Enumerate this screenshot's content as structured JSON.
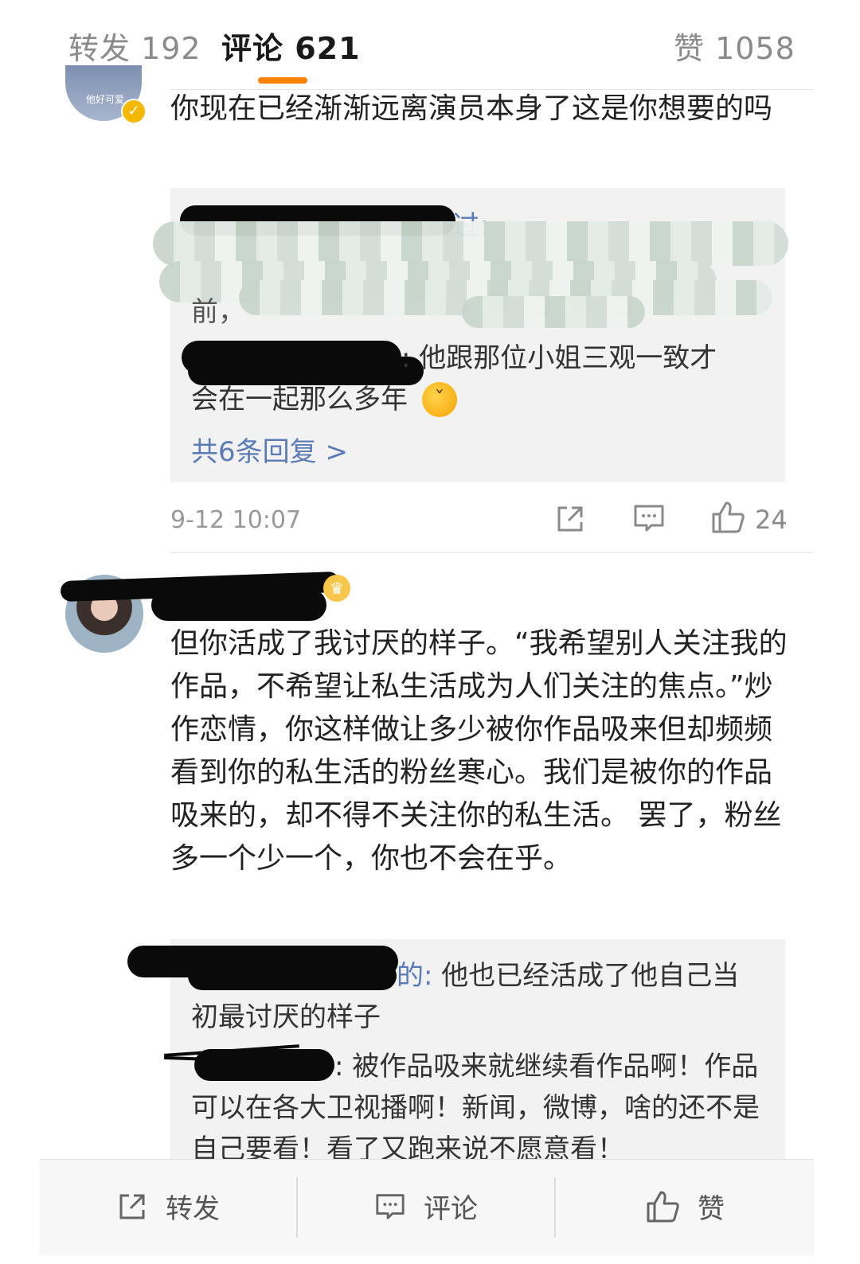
{
  "tabs": {
    "repost": "转发 192",
    "comment": "评论 621",
    "like": "赞 1058"
  },
  "comment1": {
    "text": "你现在已经渐渐远离演员本身了这是你想要的吗",
    "reply1_suffix": "过:",
    "reply1_line3_start": "前，",
    "reply2_tail": ": 他跟那位小姐三观一致才",
    "reply2_line2": "会在一起那么多年",
    "reply2_emoji": "🙃",
    "more_replies": "共6条回复 >",
    "time": "9-12 10:07",
    "likes": "24"
  },
  "comment2": {
    "text": "但你活成了我讨厌的样子。“我希望别人关注我的作品，不希望让私生活成为人们关注的焦点。”炒作恋情，你这样做让多少被你作品吸来但却频频看到你的私生活的粉丝寒心。我们是被你的作品吸来的，却不得不关注你的私生活。 罢了，粉丝多一个少一个，你也不会在乎。",
    "reply1_suffix": "的:",
    "reply1_text": " 他也已经活成了他自己当初最讨厌的样子",
    "reply2_text": ": 被作品吸来就继续看作品啊！作品可以在各大卫视播啊！新闻，微博，啥的还不是自己要看！看了又跑来说不愿意看！"
  },
  "bottom_bar": {
    "repost": "转发",
    "comment": "评论",
    "like": "赞"
  },
  "colors": {
    "accent": "#ff8200",
    "link": "#5b7bb5",
    "verified": "#f5b800"
  }
}
